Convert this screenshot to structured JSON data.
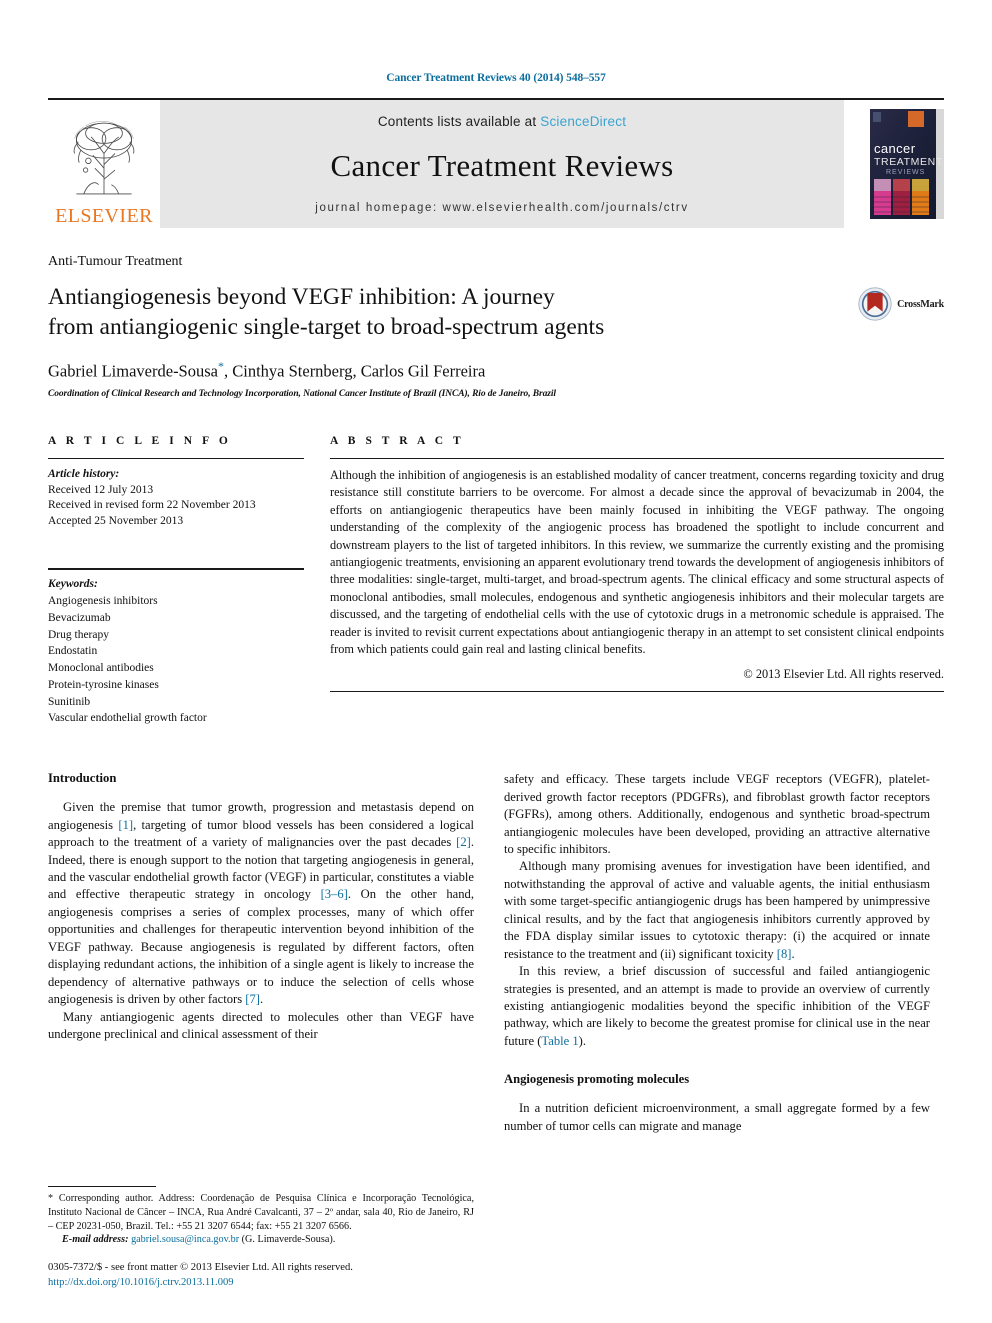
{
  "running_head": "Cancer Treatment Reviews 40 (2014) 548–557",
  "masthead": {
    "publisher": "ELSEVIER",
    "contents_prefix": "Contents lists available at ",
    "contents_link": "ScienceDirect",
    "journal_title": "Cancer Treatment Reviews",
    "homepage": "journal homepage: www.elsevierhealth.com/journals/ctrv",
    "cover_title_line1": "cancer",
    "cover_title_line2": "TREATMENT",
    "cover_title_line3": "REVIEWS"
  },
  "title_block": {
    "kicker": "Anti-Tumour Treatment",
    "title_line1": "Antiangiogenesis beyond VEGF inhibition: A journey",
    "title_line2": "from antiangiogenic single-target to broad-spectrum agents",
    "authors_part1": "Gabriel Limaverde-Sousa",
    "authors_star": "*",
    "authors_part2": ", Cinthya Sternberg, Carlos Gil Ferreira",
    "affiliation": "Coordination of Clinical Research and Technology Incorporation, National Cancer Institute of Brazil (INCA), Rio de Janeiro, Brazil",
    "crossmark_label": "CrossMark"
  },
  "article_info": {
    "heading": "A R T I C L E   I N F O",
    "history_label": "Article history:",
    "history": [
      "Received 12 July 2013",
      "Received in revised form 22 November 2013",
      "Accepted 25 November 2013"
    ],
    "keywords_label": "Keywords:",
    "keywords": [
      "Angiogenesis inhibitors",
      "Bevacizumab",
      "Drug therapy",
      "Endostatin",
      "Monoclonal antibodies",
      "Protein-tyrosine kinases",
      "Sunitinib",
      "Vascular endothelial growth factor"
    ]
  },
  "abstract": {
    "heading": "A B S T R A C T",
    "text": "Although the inhibition of angiogenesis is an established modality of cancer treatment, concerns regarding toxicity and drug resistance still constitute barriers to be overcome. For almost a decade since the approval of bevacizumab in 2004, the efforts on antiangiogenic therapeutics have been mainly focused in inhibiting the VEGF pathway. The ongoing understanding of the complexity of the angiogenic process has broadened the spotlight to include concurrent and downstream players to the list of targeted inhibitors. In this review, we summarize the currently existing and the promising antiangiogenic treatments, envisioning an apparent evolutionary trend towards the development of angiogenesis inhibitors of three modalities: single-target, multi-target, and broad-spectrum agents. The clinical efficacy and some structural aspects of monoclonal antibodies, small molecules, endogenous and synthetic angiogenesis inhibitors and their molecular targets are discussed, and the targeting of endothelial cells with the use of cytotoxic drugs in a metronomic schedule is appraised. The reader is invited to revisit current expectations about antiangiogenic therapy in an attempt to set consistent clinical endpoints from which patients could gain real and lasting clinical benefits.",
    "copyright": "© 2013 Elsevier Ltd. All rights reserved."
  },
  "body": {
    "left": {
      "section_heading": "Introduction",
      "p1_a": "Given the premise that tumor growth, progression and metastasis depend on angiogenesis ",
      "p1_ref1": "[1]",
      "p1_b": ", targeting of tumor blood vessels has been considered a logical approach to the treatment of a variety of malignancies over the past decades ",
      "p1_ref2": "[2]",
      "p1_c": ". Indeed, there is enough support to the notion that targeting angiogenesis in general, and the vascular endothelial growth factor (VEGF) in particular, constitutes a viable and effective therapeutic strategy in oncology ",
      "p1_ref3": "[3–6]",
      "p1_d": ". On the other hand, angiogenesis comprises a series of complex processes, many of which offer opportunities and challenges for therapeutic intervention beyond inhibition of the VEGF pathway. Because angiogenesis is regulated by different factors, often displaying redundant actions, the inhibition of a single agent is likely to increase the dependency of alternative pathways or to induce the selection of cells whose angiogenesis is driven by other factors ",
      "p1_ref4": "[7]",
      "p1_e": ".",
      "p2": "Many antiangiogenic agents directed to molecules other than VEGF have undergone preclinical and clinical assessment of their"
    },
    "right": {
      "p1": "safety and efficacy. These targets include VEGF receptors (VEGFR), platelet-derived growth factor receptors (PDGFRs), and fibroblast growth factor receptors (FGFRs), among others. Additionally, endogenous and synthetic broad-spectrum antiangiogenic molecules have been developed, providing an attractive alternative to specific inhibitors.",
      "p2_a": "Although many promising avenues for investigation have been identified, and notwithstanding the approval of active and valuable agents, the initial enthusiasm with some target-specific antiangiogenic drugs has been hampered by unimpressive clinical results, and by the fact that angiogenesis inhibitors currently approved by the FDA display similar issues to cytotoxic therapy: (i) the acquired or innate resistance to the treatment and (ii) significant toxicity ",
      "p2_ref": "[8]",
      "p2_b": ".",
      "p3_a": "In this review, a brief discussion of successful and failed antiangiogenic strategies is presented, and an attempt is made to provide an overview of currently existing antiangiogenic modalities beyond the specific inhibition of the VEGF pathway, which are likely to become the greatest promise for clinical use in the near future (",
      "p3_ref": "Table 1",
      "p3_b": ").",
      "section_heading": "Angiogenesis promoting molecules",
      "p4": "In a nutrition deficient microenvironment, a small aggregate formed by a few number of tumor cells can migrate and manage"
    }
  },
  "footnote": {
    "corresponding": "* Corresponding author. Address: Coordenação de Pesquisa Clínica e Incorporação Tecnológica, Instituto Nacional de Câncer – INCA, Rua André Cavalcanti, 37 – 2º andar, sala 40, Rio de Janeiro, RJ – CEP 20231-050, Brazil. Tel.: +55 21 3207 6544; fax: +55 21 3207 6566.",
    "email_label": "E-mail address:",
    "email": "gabriel.sousa@inca.gov.br",
    "email_suffix": " (G. Limaverde-Sousa).",
    "imprint": "0305-7372/$ - see front matter © 2013 Elsevier Ltd. All rights reserved.",
    "doi": "http://dx.doi.org/10.1016/j.ctrv.2013.11.009"
  },
  "colors": {
    "link_blue": "#0b6e9e",
    "sciencedirect_blue": "#3ba3d0",
    "elsevier_orange": "#e87722",
    "masthead_gray": "#e6e6e6"
  }
}
